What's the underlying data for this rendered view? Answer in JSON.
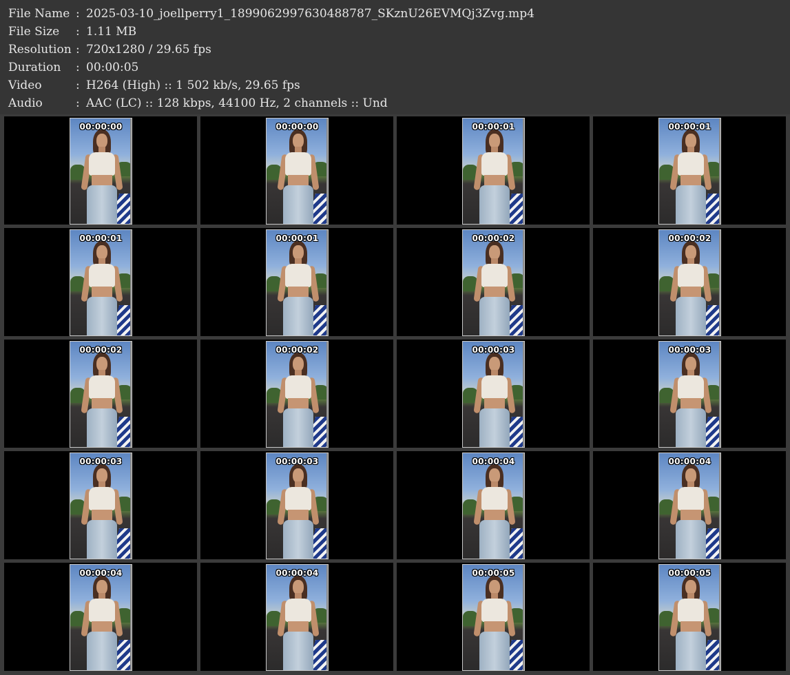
{
  "info": {
    "rows": [
      {
        "key": "File Name",
        "sep": ":",
        "value": "2025-03-10_joellperry1_1899062997630488787_SKznU26EVMQj3Zvg.mp4"
      },
      {
        "key": "File Size",
        "sep": ":",
        "value": "1.11 MB"
      },
      {
        "key": "Resolution",
        "sep": ":",
        "value": "720x1280 / 29.65 fps"
      },
      {
        "key": "Duration",
        "sep": ":",
        "value": "00:00:05"
      },
      {
        "key": "Video",
        "sep": ":",
        "value": "H264 (High) :: 1 502 kb/s, 29.65 fps"
      },
      {
        "key": "Audio",
        "sep": ":",
        "value": "AAC (LC) :: 128 kbps, 44100 Hz, 2 channels :: Und"
      }
    ]
  },
  "thumbnails": [
    {
      "timestamp": "00:00:00"
    },
    {
      "timestamp": "00:00:00"
    },
    {
      "timestamp": "00:00:01"
    },
    {
      "timestamp": "00:00:01"
    },
    {
      "timestamp": "00:00:01"
    },
    {
      "timestamp": "00:00:01"
    },
    {
      "timestamp": "00:00:02"
    },
    {
      "timestamp": "00:00:02"
    },
    {
      "timestamp": "00:00:02"
    },
    {
      "timestamp": "00:00:02"
    },
    {
      "timestamp": "00:00:03"
    },
    {
      "timestamp": "00:00:03"
    },
    {
      "timestamp": "00:00:03"
    },
    {
      "timestamp": "00:00:03"
    },
    {
      "timestamp": "00:00:04"
    },
    {
      "timestamp": "00:00:04"
    },
    {
      "timestamp": "00:00:04"
    },
    {
      "timestamp": "00:00:04"
    },
    {
      "timestamp": "00:00:05"
    },
    {
      "timestamp": "00:00:05"
    }
  ],
  "colors": {
    "background": "#353535",
    "cell_background": "#000000",
    "text": "#e6e6e6",
    "timestamp_text": "#ffffff"
  }
}
